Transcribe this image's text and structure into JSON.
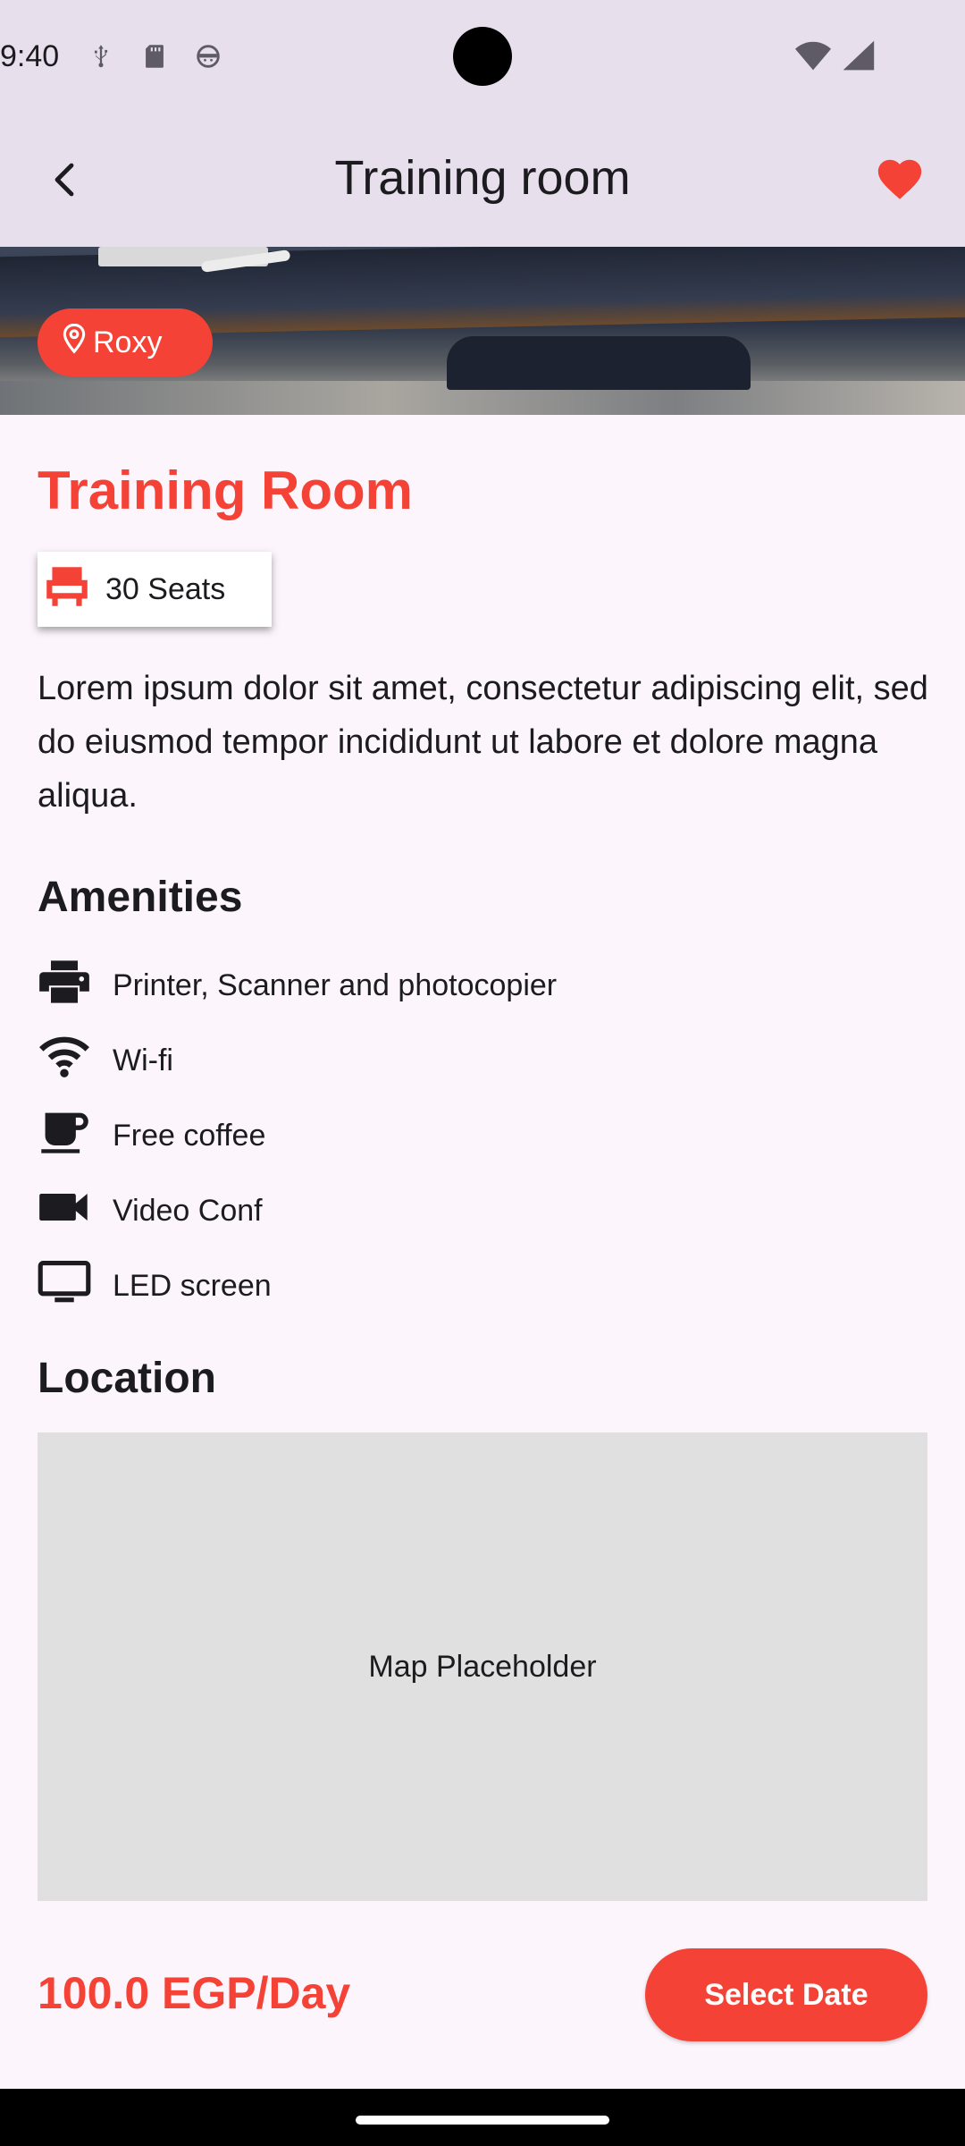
{
  "status_bar": {
    "time": "9:40",
    "left_icons": [
      "usb-debug-icon",
      "sd-card-icon",
      "android-icon"
    ],
    "right_icons": [
      "wifi-signal-icon",
      "cell-signal-icon"
    ]
  },
  "app_bar": {
    "title": "Training room",
    "back_icon": "chevron-left-icon",
    "favorite_icon": "heart-icon",
    "favorite_color": "#f44336"
  },
  "hero": {
    "location_chip": "Roxy",
    "location_icon": "map-pin-icon"
  },
  "room": {
    "title": "Training Room",
    "seats": "30 Seats",
    "description": "Lorem ipsum dolor sit amet, consectetur adipiscing elit, sed do eiusmod tempor incididunt ut labore et dolore magna aliqua."
  },
  "amenities": {
    "title": "Amenities",
    "items": [
      {
        "label": "Printer, Scanner and photocopier",
        "icon": "printer-icon"
      },
      {
        "label": "Wi-fi",
        "icon": "wifi-icon"
      },
      {
        "label": "Free coffee",
        "icon": "coffee-icon"
      },
      {
        "label": "Video Conf",
        "icon": "video-camera-icon"
      },
      {
        "label": "LED screen",
        "icon": "monitor-icon"
      }
    ]
  },
  "location": {
    "title": "Location",
    "map_text": "Map Placeholder"
  },
  "footer": {
    "price": "100.0 EGP/Day",
    "select_date_label": "Select Date"
  },
  "colors": {
    "accent": "#f44336",
    "app_bar_bg": "#e7e0ec",
    "page_bg": "#fcf5fc",
    "map_bg": "#e0e0e0"
  }
}
